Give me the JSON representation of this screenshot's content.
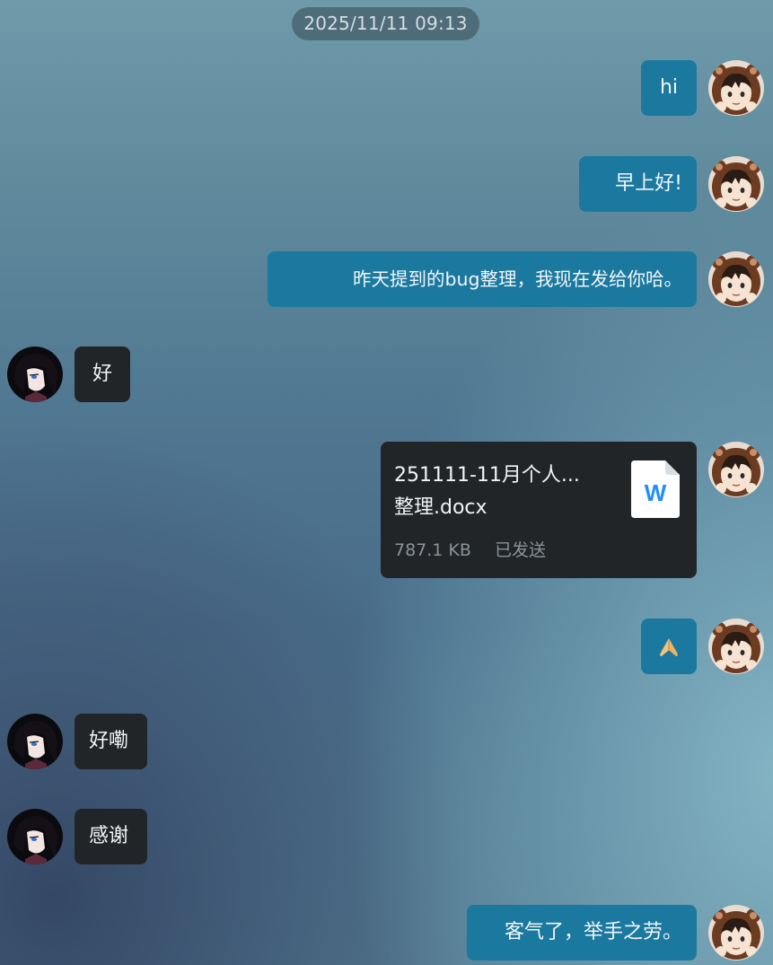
{
  "timestamp": "2025/11/11 09:13",
  "messages": [
    {
      "side": "me",
      "text": "hi"
    },
    {
      "side": "me",
      "text": "早上好!"
    },
    {
      "side": "me",
      "text": "昨天提到的bug整理，我现在发给你哈。"
    },
    {
      "side": "other",
      "text": "好"
    },
    {
      "side": "me",
      "type": "file",
      "file": {
        "name_line1": "251111-11月个人...",
        "name_line2": "整理.docx",
        "size": "787.1 KB",
        "status": "已发送",
        "icon": "word-doc-icon",
        "icon_letter": "W"
      }
    },
    {
      "side": "me",
      "emoji": "folded-hands-emoji"
    },
    {
      "side": "other",
      "text": "好嘞"
    },
    {
      "side": "other",
      "text": "感谢"
    },
    {
      "side": "me",
      "text": "客气了，举手之劳。"
    }
  ],
  "colors": {
    "my_bubble": "#1b79a0",
    "other_bubble": "#212528",
    "word_icon_blue": "#1f8fff"
  }
}
